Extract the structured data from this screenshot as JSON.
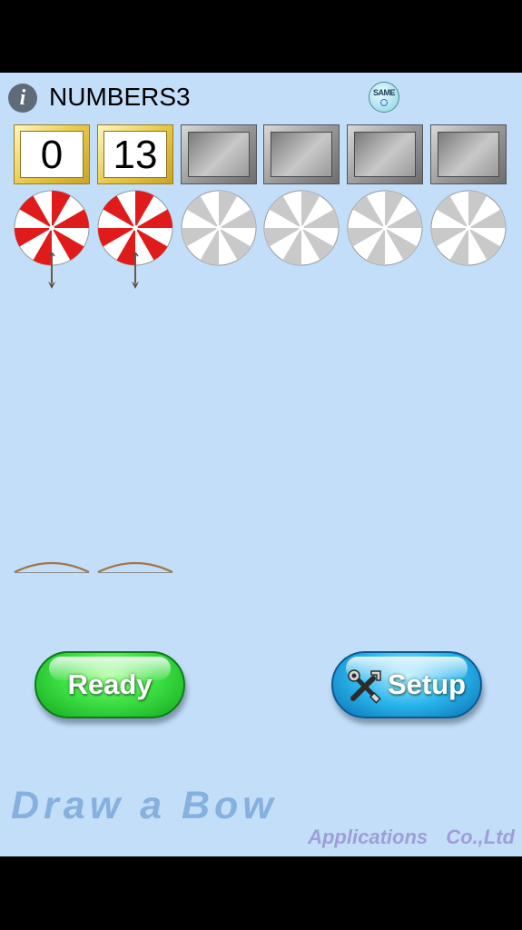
{
  "header": {
    "title": "NUMBERS3",
    "info_icon_glyph": "i",
    "same_badge_label": "SAME"
  },
  "slots": [
    {
      "state": "filled",
      "value": "0"
    },
    {
      "state": "filled",
      "value": "13"
    },
    {
      "state": "empty"
    },
    {
      "state": "empty"
    },
    {
      "state": "empty"
    },
    {
      "state": "empty"
    }
  ],
  "targets": [
    {
      "state": "hit",
      "color": "#e01b1b"
    },
    {
      "state": "hit",
      "color": "#e01b1b"
    },
    {
      "state": "inactive",
      "color": "#c9c9c9"
    },
    {
      "state": "inactive",
      "color": "#c9c9c9"
    },
    {
      "state": "inactive",
      "color": "#c9c9c9"
    },
    {
      "state": "inactive",
      "color": "#c9c9c9"
    }
  ],
  "bows_remaining": 2,
  "buttons": {
    "ready_label": "Ready",
    "setup_label": "Setup"
  },
  "footer": {
    "brand": "Draw a Bow",
    "company": "Applications Co.,Ltd"
  },
  "colors": {
    "background": "#c3def8",
    "ready": "#3fe246",
    "setup": "#2ab6ec",
    "bow": "#a47448"
  },
  "icons": [
    "info-icon",
    "same-badge-icon",
    "tools-icon",
    "target-icon",
    "arrow-icon",
    "bow-icon"
  ]
}
